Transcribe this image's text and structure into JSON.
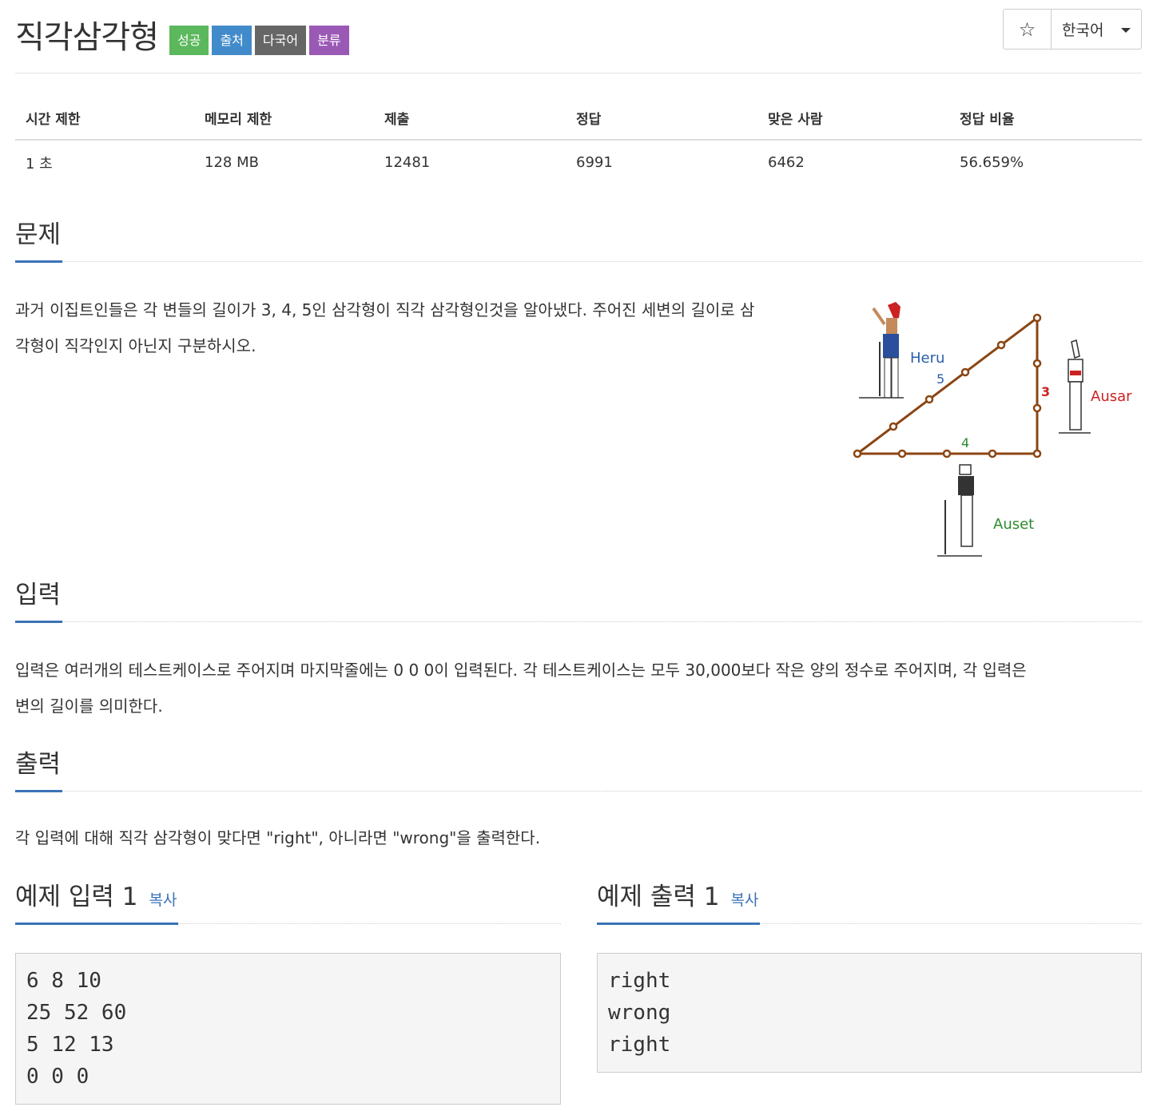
{
  "header": {
    "title": "직각삼각형",
    "badges": [
      {
        "label": "성공",
        "color": "#5cb85c"
      },
      {
        "label": "출처",
        "color": "#428bca"
      },
      {
        "label": "다국어",
        "color": "#666666"
      },
      {
        "label": "분류",
        "color": "#9b59b6"
      }
    ],
    "star_icon": "☆",
    "language": "한국어"
  },
  "info_table": {
    "headers": [
      "시간 제한",
      "메모리 제한",
      "제출",
      "정답",
      "맞은 사람",
      "정답 비율"
    ],
    "values": [
      "1 초",
      "128 MB",
      "12481",
      "6991",
      "6462",
      "56.659%"
    ]
  },
  "problem": {
    "heading": "문제",
    "text_line1": "과거 이집트인들은 각 변들의 길이가 3, 4, 5인 삼각형이 직각 삼각형인것을 알아냈다. 주어진 세변의 길이로 삼",
    "text_line2": "각형이 직각인지 아닌지 구분하시오.",
    "figure": {
      "label_heru": "Heru",
      "label_ausar": "Ausar",
      "label_auset": "Auset",
      "side_5": "5",
      "side_3": "3",
      "side_4": "4"
    }
  },
  "input": {
    "heading": "입력",
    "text_line1": "입력은 여러개의 테스트케이스로 주어지며 마지막줄에는 0 0 0이 입력된다. 각 테스트케이스는 모두 30,000보다 작은 양의 정수로 주어지며, 각 입력은",
    "text_line2": "변의 길이를 의미한다."
  },
  "output": {
    "heading": "출력",
    "text": "각 입력에 대해 직각 삼각형이 맞다면 \"right\", 아니라면 \"wrong\"을 출력한다."
  },
  "sample_input": {
    "heading": "예제 입력 1",
    "copy_label": "복사",
    "content": "6 8 10\n25 52 60\n5 12 13\n0 0 0"
  },
  "sample_output": {
    "heading": "예제 출력 1",
    "copy_label": "복사",
    "content": "right\nwrong\nright"
  }
}
